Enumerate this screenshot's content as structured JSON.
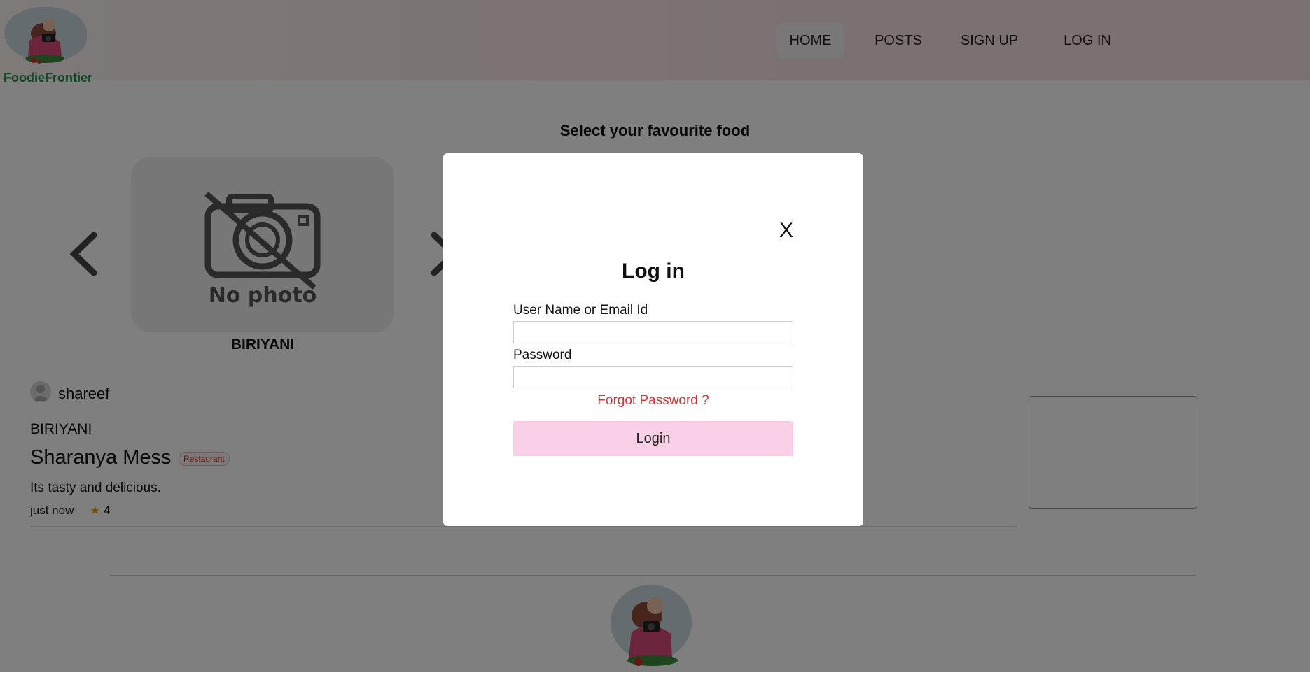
{
  "header": {
    "brand": "FoodieFrontier",
    "nav": [
      {
        "label": "HOME",
        "active": true
      },
      {
        "label": "POSTS",
        "active": false
      },
      {
        "label": "SIGN UP",
        "active": false
      },
      {
        "label": "LOG IN",
        "active": false
      }
    ]
  },
  "main": {
    "section_title": "Select your favourite food",
    "carousel": {
      "prev_icon": "chevron-left-icon",
      "next_icon": "chevron-right-icon",
      "card": {
        "placeholder_text": "No photo",
        "label": "BIRIYANI"
      }
    },
    "post": {
      "user": "shareef",
      "category": "BIRIYANI",
      "place": "Sharanya Mess",
      "badge": "Restaurant",
      "description": "Its tasty and delicious.",
      "time": "just now",
      "rating": "4"
    }
  },
  "modal": {
    "title": "Log in",
    "close": "X",
    "username_label": "User Name or Email Id",
    "username_value": "",
    "password_label": "Password",
    "password_value": "",
    "forgot_link": "Forgot Password ?",
    "submit_label": "Login"
  },
  "colors": {
    "brand_green": "#1f8a4a",
    "login_button": "#f9d0e6",
    "forgot_link": "#d33636",
    "star": "#e6a01e"
  }
}
